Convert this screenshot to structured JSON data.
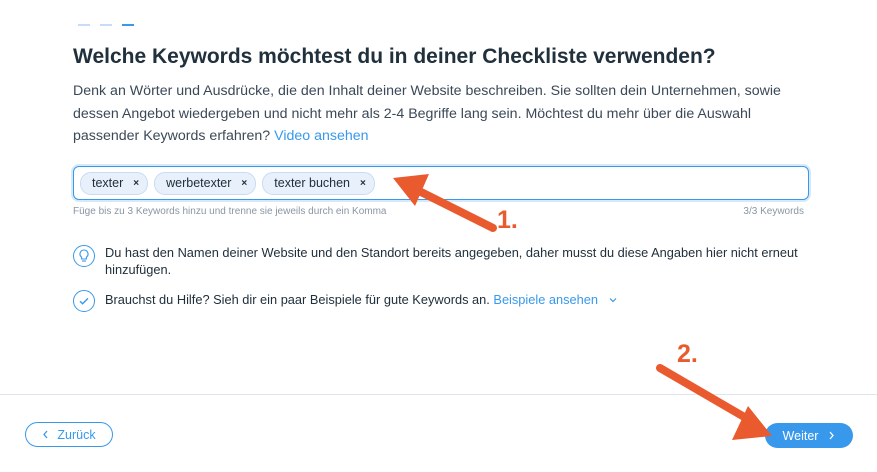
{
  "title": "Welche Keywords möchtest du in deiner Checkliste verwenden?",
  "description": {
    "text": "Denk an Wörter und Ausdrücke, die den Inhalt deiner Website beschreiben. Sie sollten dein Unternehmen, sowie dessen Angebot wiedergeben und nicht mehr als 2-4 Begriffe lang sein. Möchtest du mehr über die Auswahl passender Keywords erfahren?",
    "link": "Video ansehen"
  },
  "keywords": [
    "texter",
    "werbetexter",
    "texter buchen"
  ],
  "remove_glyph": "×",
  "hint": "Füge bis zu 3 Keywords hinzu und trenne sie jeweils durch ein Komma",
  "count": "3/3 Keywords",
  "info1": "Du hast den Namen deiner Website und den Standort bereits angegeben, daher musst du diese Angaben hier nicht erneut hinzufügen.",
  "info2": {
    "text": "Brauchst du Hilfe? Sieh dir ein paar Beispiele für gute Keywords an.",
    "link": "Beispiele ansehen"
  },
  "buttons": {
    "back": "Zurück",
    "next": "Weiter"
  },
  "annotations": {
    "one": "1.",
    "two": "2."
  },
  "icons": {
    "info1": "lightbulb-icon",
    "info2": "check-circle-icon"
  },
  "colors": {
    "accent": "#3899ec",
    "annotation": "#ea5a2f"
  }
}
